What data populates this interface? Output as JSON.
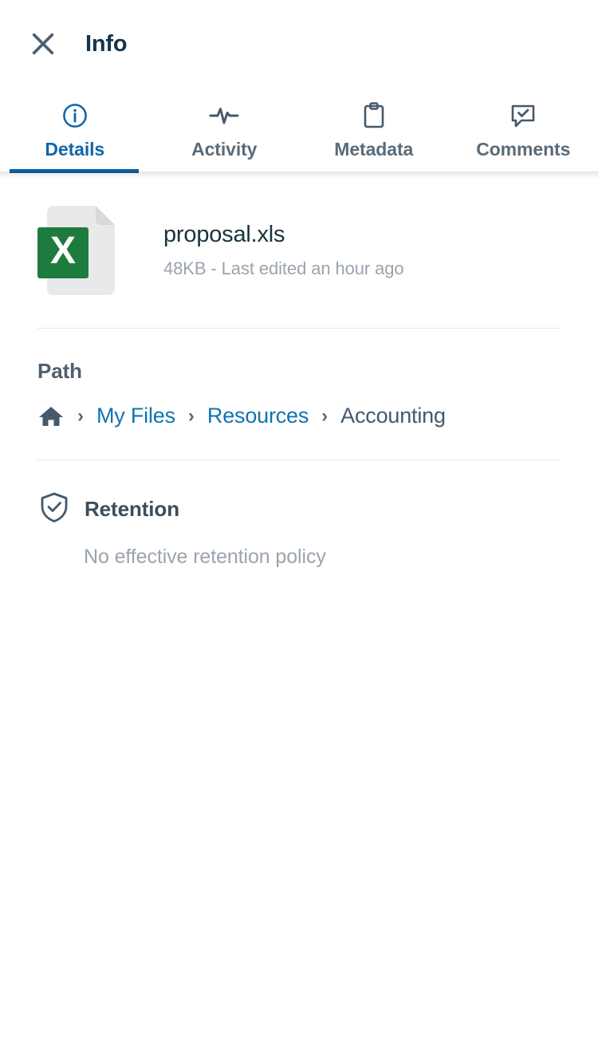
{
  "header": {
    "title": "Info",
    "close_icon": "close-icon"
  },
  "tabs": [
    {
      "label": "Details",
      "icon": "info-circle-icon",
      "active": true
    },
    {
      "label": "Activity",
      "icon": "pulse-icon",
      "active": false
    },
    {
      "label": "Metadata",
      "icon": "clipboard-icon",
      "active": false
    },
    {
      "label": "Comments",
      "icon": "comment-check-icon",
      "active": false
    }
  ],
  "file": {
    "name": "proposal.xls",
    "meta": "48KB - Last edited an hour ago",
    "icon": "excel-file-icon",
    "icon_letter": "X"
  },
  "path": {
    "title": "Path",
    "home_icon": "home-icon",
    "separator": "›",
    "crumbs": [
      {
        "label": "My Files",
        "link": true
      },
      {
        "label": "Resources",
        "link": true
      },
      {
        "label": "Accounting",
        "link": false
      }
    ]
  },
  "retention": {
    "icon": "shield-check-icon",
    "title": "Retention",
    "subtitle": "No effective retention policy"
  },
  "colors": {
    "accent_blue": "#0e5f9e",
    "link_blue": "#1173b0",
    "tab_inactive": "#5a6b78",
    "title_dark": "#17334a",
    "muted": "#9aa4ae",
    "excel_green": "#1e7b3e",
    "divider": "#e6e7e8"
  }
}
